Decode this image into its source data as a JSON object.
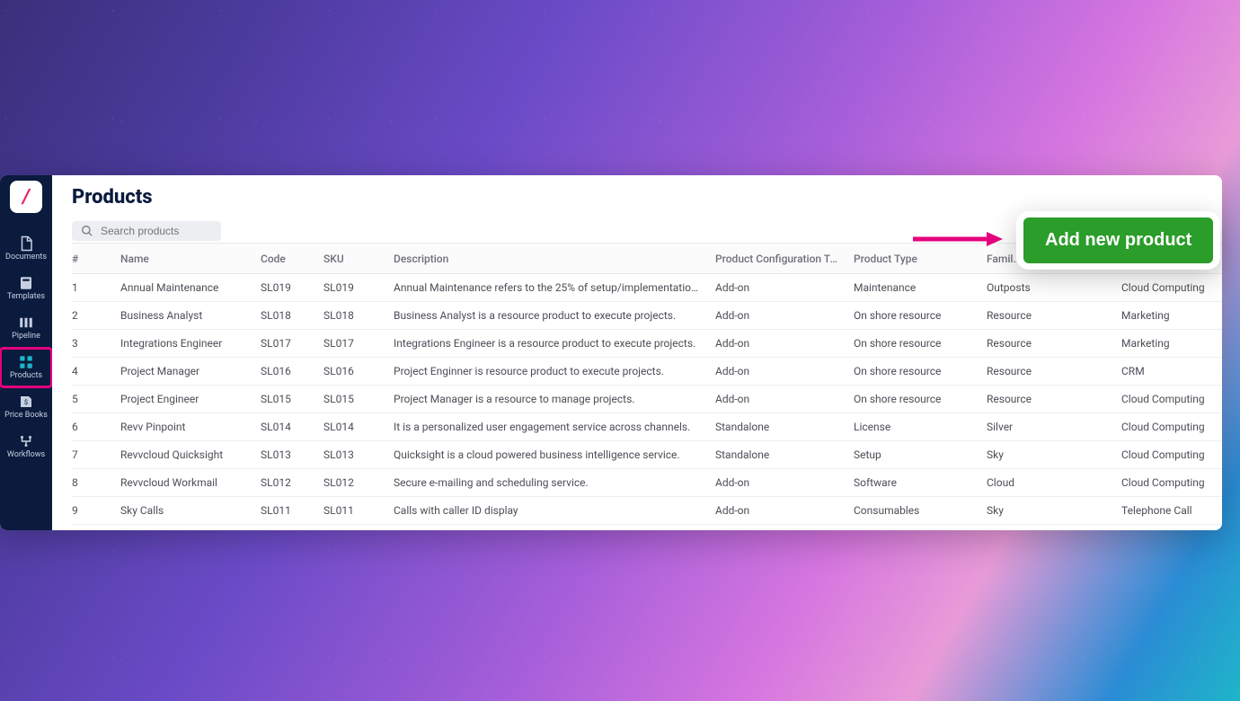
{
  "logo": {
    "char": "/"
  },
  "sidebar": {
    "items": [
      {
        "id": "documents",
        "label": "Documents",
        "active": false
      },
      {
        "id": "templates",
        "label": "Templates",
        "active": false
      },
      {
        "id": "pipeline",
        "label": "Pipeline",
        "active": false
      },
      {
        "id": "products",
        "label": "Products",
        "active": true
      },
      {
        "id": "pricebooks",
        "label": "Price Books",
        "active": false
      },
      {
        "id": "workflows",
        "label": "Workflows",
        "active": false
      }
    ]
  },
  "page": {
    "title": "Products"
  },
  "search": {
    "placeholder": "Search products"
  },
  "table": {
    "columns": [
      "#",
      "Name",
      "Code",
      "SKU",
      "Description",
      "Product Configuration Type",
      "Product Type",
      "Family",
      ""
    ],
    "family_header_truncated": "Famil.",
    "rows": [
      {
        "idx": "1",
        "name": "Annual Maintenance",
        "code": "SL019",
        "sku": "SL019",
        "desc": "Annual Maintenance refers to the 25% of setup/implementation...",
        "config": "Add-on",
        "ptype": "Maintenance",
        "family": "Outposts",
        "extra": "Cloud Computing"
      },
      {
        "idx": "2",
        "name": "Business Analyst",
        "code": "SL018",
        "sku": "SL018",
        "desc": "Business Analyst is a resource product to execute projects.",
        "config": "Add-on",
        "ptype": "On shore resource",
        "family": "Resource",
        "extra": "Marketing"
      },
      {
        "idx": "3",
        "name": "Integrations Engineer",
        "code": "SL017",
        "sku": "SL017",
        "desc": "Integrations Engineer is a resource product to execute projects.",
        "config": "Add-on",
        "ptype": "On shore resource",
        "family": "Resource",
        "extra": "Marketing"
      },
      {
        "idx": "4",
        "name": "Project Manager",
        "code": "SL016",
        "sku": "SL016",
        "desc": "Project Enginner is resource product to execute projects.",
        "config": "Add-on",
        "ptype": "On shore resource",
        "family": "Resource",
        "extra": "CRM"
      },
      {
        "idx": "5",
        "name": "Project Engineer",
        "code": "SL015",
        "sku": "SL015",
        "desc": "Project Manager is a resource to manage projects.",
        "config": "Add-on",
        "ptype": "On shore resource",
        "family": "Resource",
        "extra": "Cloud Computing"
      },
      {
        "idx": "6",
        "name": "Revv Pinpoint",
        "code": "SL014",
        "sku": "SL014",
        "desc": "It is a personalized user engagement service across channels.",
        "config": "Standalone",
        "ptype": "License",
        "family": "Silver",
        "extra": "Cloud Computing"
      },
      {
        "idx": "7",
        "name": "Revvcloud Quicksight",
        "code": "SL013",
        "sku": "SL013",
        "desc": "Quicksight is a cloud powered business intelligence service.",
        "config": "Standalone",
        "ptype": "Setup",
        "family": "Sky",
        "extra": "Cloud Computing"
      },
      {
        "idx": "8",
        "name": "Revvcloud Workmail",
        "code": "SL012",
        "sku": "SL012",
        "desc": "Secure e-mailing and scheduling service.",
        "config": "Add-on",
        "ptype": "Software",
        "family": "Cloud",
        "extra": "Cloud Computing"
      },
      {
        "idx": "9",
        "name": "Sky Calls",
        "code": "SL011",
        "sku": "SL011",
        "desc": "Calls with caller ID display",
        "config": "Add-on",
        "ptype": "Consumables",
        "family": "Sky",
        "extra": "Telephone Call"
      }
    ]
  },
  "cta": {
    "add_product": "Add new product"
  },
  "colors": {
    "sidebar_bg": "#0a1b3d",
    "brand_pink": "#e6007e",
    "cta_green": "#2a9d2a",
    "accent_teal": "#1fb5c9"
  }
}
